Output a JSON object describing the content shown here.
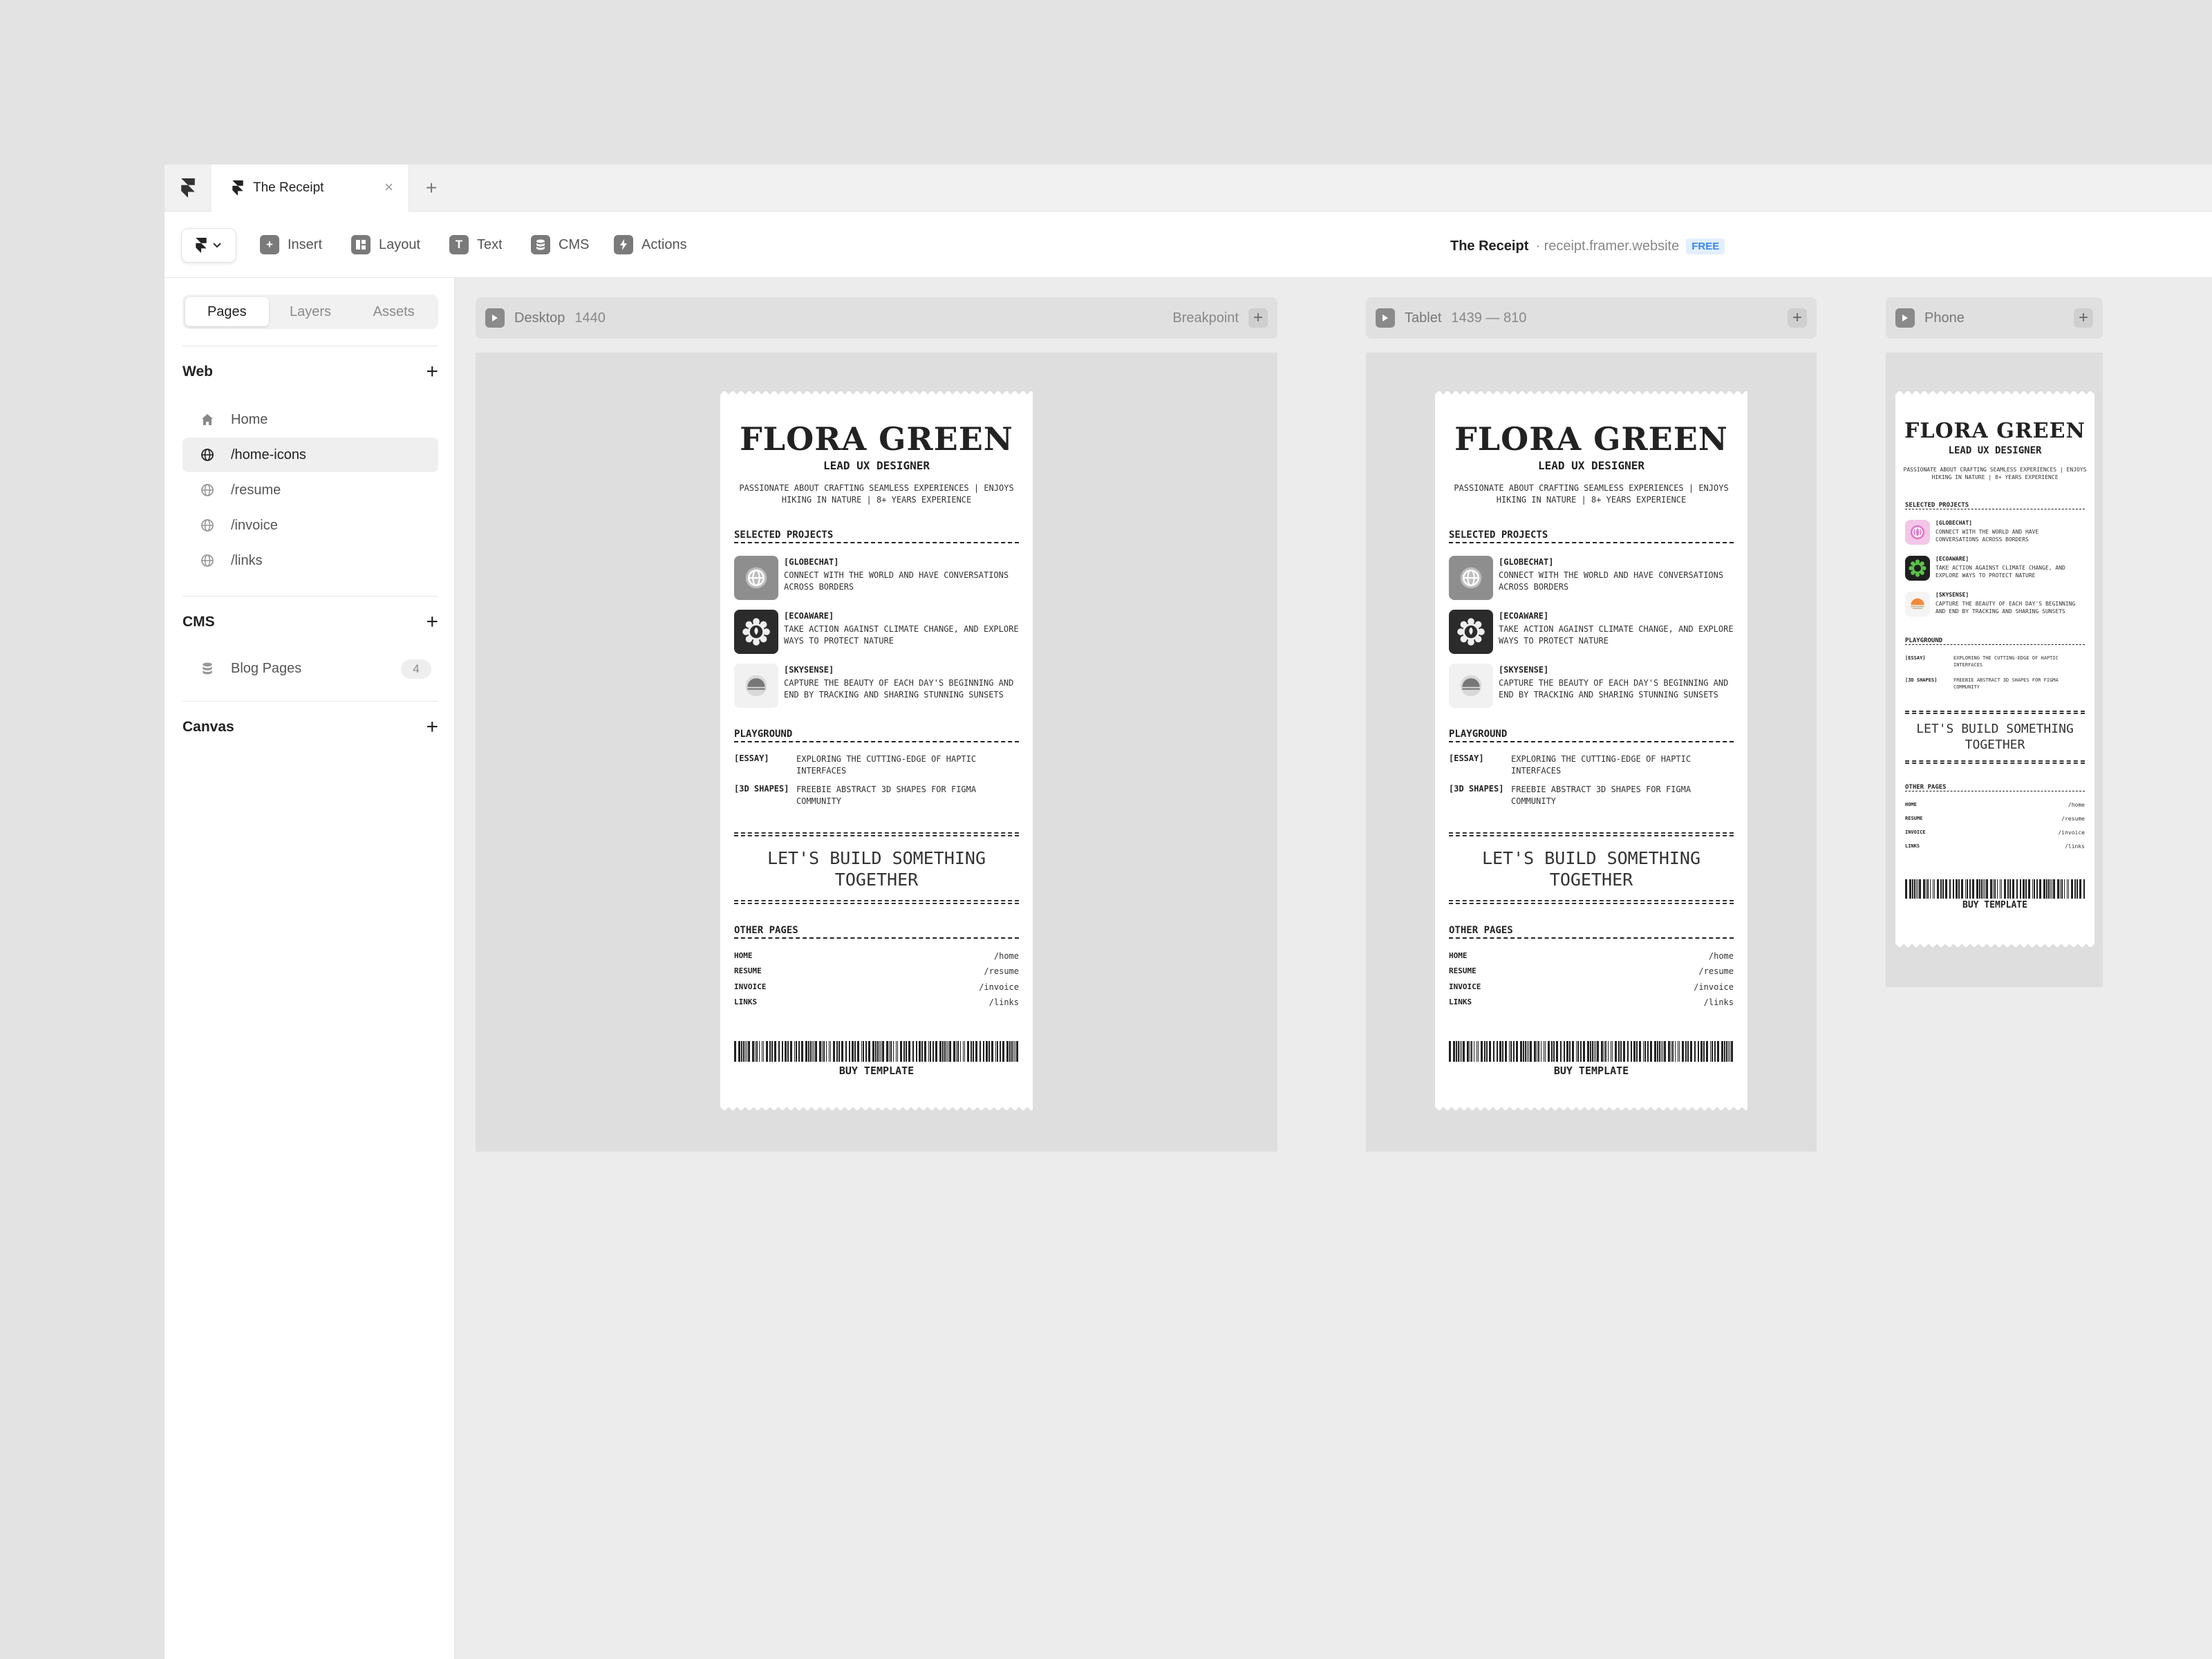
{
  "tabbar": {
    "tab_title": "The Receipt",
    "close_glyph": "×",
    "add_glyph": "+"
  },
  "toolbar": {
    "insert": "Insert",
    "layout": "Layout",
    "text": "Text",
    "cms": "CMS",
    "actions": "Actions",
    "site_name": "The Receipt",
    "site_url": "· receipt.framer.website",
    "plan_badge": "FREE"
  },
  "sidebar": {
    "tabs": [
      "Pages",
      "Layers",
      "Assets"
    ],
    "web_title": "Web",
    "pages": [
      "Home",
      "/home-icons",
      "/resume",
      "/invoice",
      "/links"
    ],
    "cms_title": "CMS",
    "cms_items": [
      {
        "label": "Blog Pages",
        "count": "4"
      }
    ],
    "canvas_title": "Canvas",
    "plus": "+"
  },
  "frames": {
    "desktop": {
      "name": "Desktop",
      "size": "1440",
      "breakpoint": "Breakpoint"
    },
    "tablet": {
      "name": "Tablet",
      "size": "1439 — 810"
    },
    "phone": {
      "name": "Phone"
    }
  },
  "receipt": {
    "name": "FLORA GREEN",
    "role": "LEAD UX DESIGNER",
    "tagline_1": "PASSIONATE ABOUT CRAFTING SEAMLESS EXPERIENCES | ENJOYS",
    "tagline_2": "HIKING IN NATURE |  8+ YEARS EXPERIENCE",
    "selected_projects": "SELECTED PROJECTS",
    "projects": [
      {
        "title": "[GLOBECHAT]",
        "desc_1": "CONNECT WITH THE WORLD AND HAVE CONVERSATIONS",
        "desc_2": "ACROSS BORDERS",
        "phone_1": "CONNECT WITH THE WORLD AND HAVE",
        "phone_2": "CONVERSATIONS ACROSS BORDERS"
      },
      {
        "title": "[ECOAWARE]",
        "desc_1": "TAKE ACTION AGAINST CLIMATE CHANGE, AND EXPLORE",
        "desc_2": "WAYS TO PROTECT NATURE",
        "phone_1": "TAKE ACTION AGAINST CLIMATE CHANGE, AND",
        "phone_2": "EXPLORE WAYS TO PROTECT NATURE"
      },
      {
        "title": "[SKYSENSE]",
        "desc_1": "CAPTURE THE BEAUTY OF EACH DAY'S BEGINNING AND",
        "desc_2": "END BY TRACKING AND SHARING STUNNING SUNSETS",
        "phone_1": "CAPTURE THE BEAUTY OF EACH DAY'S BEGINNING",
        "phone_2": "AND END BY TRACKING AND SHARING SUNSETS"
      }
    ],
    "playground": "PLAYGROUND",
    "play_items": [
      {
        "key": "[ESSAY]",
        "val_1": "EXPLORING THE CUTTING-EDGE OF HAPTIC",
        "val_2": "INTERFACES"
      },
      {
        "key": "[3D SHAPES]",
        "val_1": "FREEBIE ABSTRACT 3D SHAPES FOR FIGMA",
        "val_2": "COMMUNITY"
      }
    ],
    "cta_1": "LET'S BUILD SOMETHING",
    "cta_2": "TOGETHER",
    "other_pages": "OTHER PAGES",
    "links": [
      {
        "label": "HOME",
        "path": "/home"
      },
      {
        "label": "RESUME",
        "path": "/resume"
      },
      {
        "label": "INVOICE",
        "path": "/invoice"
      },
      {
        "label": "LINKS",
        "path": "/links"
      }
    ],
    "buy": "BUY TEMPLATE"
  },
  "colors": {
    "accent_blue": "#3a86e8",
    "phone_globechat": "#e07ac8",
    "phone_ecoaware": "#5cc24a",
    "phone_skysense": "#f28a3c"
  }
}
